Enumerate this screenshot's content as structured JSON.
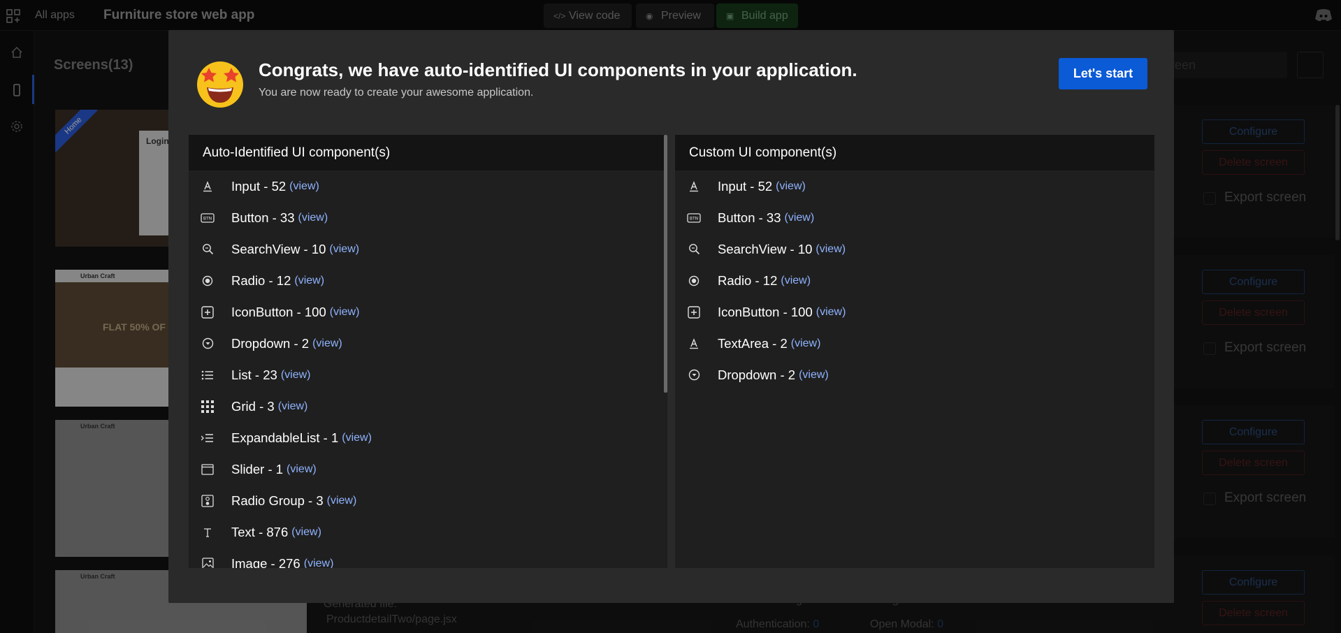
{
  "topbar": {
    "all_apps": "All apps",
    "app_title": "Furniture store web app",
    "view_code": "View code",
    "preview": "Preview",
    "build_app": "Build app"
  },
  "background": {
    "screens_title": "Screens(13)",
    "search_placeholder": "creen",
    "configure": "Configure",
    "delete_screen": "Delete screen",
    "export_screen": "Export screen",
    "thumb1_badge": "Home",
    "thumb1_login": "Login",
    "thumb2_brand": "Urban Craft",
    "thumb2_banner": "FLAT 50% OF",
    "thumb3_brand": "Urban Craft",
    "thumb4_brand": "Urban Craft",
    "generated_file_label": "Generated file:",
    "generated_file": "ProductdetailTwo/page.jsx",
    "stat_auth": "Authentication:",
    "stat_auth_val": "0",
    "stat_modal": "Open Modal:",
    "stat_modal_val": "0",
    "stat_view": "Visible changes:",
    "stat_nav": "Navigation:"
  },
  "modal": {
    "title": "Congrats, we have auto-identified UI components in your application.",
    "subtitle": "You are now ready to create your awesome application.",
    "start_button": "Let's start",
    "left_heading": "Auto-Identified UI component(s)",
    "right_heading": "Custom UI component(s)",
    "view_link": "(view)",
    "left_items": [
      {
        "label": "Input - 52",
        "icon": "text-input-icon"
      },
      {
        "label": "Button - 33",
        "icon": "button-icon"
      },
      {
        "label": "SearchView - 10",
        "icon": "search-icon"
      },
      {
        "label": "Radio - 12",
        "icon": "radio-icon"
      },
      {
        "label": "IconButton - 100",
        "icon": "plus-box-icon"
      },
      {
        "label": "Dropdown - 2",
        "icon": "dropdown-icon"
      },
      {
        "label": "List - 23",
        "icon": "list-icon"
      },
      {
        "label": "Grid - 3",
        "icon": "grid-icon"
      },
      {
        "label": "ExpandableList - 1",
        "icon": "expandable-list-icon"
      },
      {
        "label": "Slider - 1",
        "icon": "slider-icon"
      },
      {
        "label": "Radio Group - 3",
        "icon": "radio-group-icon"
      },
      {
        "label": "Text - 876",
        "icon": "text-icon"
      },
      {
        "label": "Image - 276",
        "icon": "image-icon"
      }
    ],
    "right_items": [
      {
        "label": "Input - 52",
        "icon": "text-input-icon"
      },
      {
        "label": "Button - 33",
        "icon": "button-icon"
      },
      {
        "label": "SearchView - 10",
        "icon": "search-icon"
      },
      {
        "label": "Radio - 12",
        "icon": "radio-icon"
      },
      {
        "label": "IconButton - 100",
        "icon": "plus-box-icon"
      },
      {
        "label": "TextArea - 2",
        "icon": "text-input-icon"
      },
      {
        "label": "Dropdown - 2",
        "icon": "dropdown-icon"
      }
    ]
  },
  "colors": {
    "accent": "#0b5ad6",
    "link": "#8fb3ff",
    "build": "#1f6b2c"
  }
}
